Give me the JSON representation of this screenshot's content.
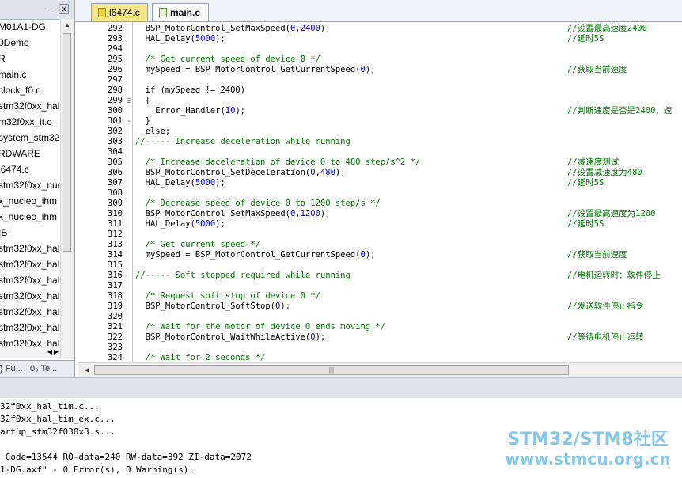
{
  "project_panel": {
    "pin_glyph": "―",
    "close_glyph": "×",
    "items": [
      "M01A1-DG",
      "0Demo",
      "R",
      "main.c",
      "clock_f0.c",
      "stm32f0xx_hal",
      "m32f0xx_it.c",
      "system_stm32",
      "RDWARE",
      "l6474.c",
      "stm32f0xx_nuc",
      "x_nucleo_ihm",
      "x_nucleo_ihm",
      "IB",
      "stm32f0xx_hal",
      "stm32f0xx_hal",
      "stm32f0xx_hal",
      "stm32f0xx_hal",
      "stm32f0xx_hal",
      "stm32f0xx_hal",
      "stm32f0xx_hal"
    ],
    "tabs": {
      "functions": "} Fu...",
      "templates": "0₀ Te..."
    }
  },
  "file_tabs": [
    {
      "label": "l6474.c",
      "active": false
    },
    {
      "label": "main.c",
      "active": true
    }
  ],
  "code_lines": [
    {
      "n": "292",
      "f": "",
      "c": "  BSP_MotorControl_SetMaxSpeed(0,2400);",
      "m": "//设置最高速度2400"
    },
    {
      "n": "293",
      "f": "",
      "c": "  HAL_Delay(5000);",
      "m": "//延时5S"
    },
    {
      "n": "294",
      "f": "",
      "c": "",
      "m": ""
    },
    {
      "n": "295",
      "f": "",
      "c": "  /* Get current speed of device 0 */",
      "m": ""
    },
    {
      "n": "296",
      "f": "",
      "c": "  mySpeed = BSP_MotorControl_GetCurrentSpeed(0);",
      "m": "//获取当前速度"
    },
    {
      "n": "297",
      "f": "",
      "c": "",
      "m": ""
    },
    {
      "n": "298",
      "f": "",
      "c": "  if (mySpeed != 2400)",
      "m": ""
    },
    {
      "n": "299",
      "f": "⊟",
      "c": "  {",
      "m": ""
    },
    {
      "n": "300",
      "f": "",
      "c": "    Error_Handler(10);",
      "m": "//判断速度是否是2400，速"
    },
    {
      "n": "301",
      "f": "-",
      "c": "  }",
      "m": ""
    },
    {
      "n": "302",
      "f": "",
      "c": "  else;",
      "m": ""
    },
    {
      "n": "303",
      "f": "",
      "c": "//----- Increase deceleration while running",
      "m": ""
    },
    {
      "n": "304",
      "f": "",
      "c": "",
      "m": ""
    },
    {
      "n": "305",
      "f": "",
      "c": "  /* Increase deceleration of device 0 to 480 step/s^2 */",
      "m": "//减速度测试"
    },
    {
      "n": "306",
      "f": "",
      "c": "  BSP_MotorControl_SetDeceleration(0,480);",
      "m": "//设置减速度为480"
    },
    {
      "n": "307",
      "f": "",
      "c": "  HAL_Delay(5000);",
      "m": "//延时5S"
    },
    {
      "n": "308",
      "f": "",
      "c": "",
      "m": ""
    },
    {
      "n": "309",
      "f": "",
      "c": "  /* Decrease speed of device 0 to 1200 step/s */",
      "m": ""
    },
    {
      "n": "310",
      "f": "",
      "c": "  BSP_MotorControl_SetMaxSpeed(0,1200);",
      "m": "//设置最高速度为1200"
    },
    {
      "n": "311",
      "f": "",
      "c": "  HAL_Delay(5000);",
      "m": "//延时5S"
    },
    {
      "n": "312",
      "f": "",
      "c": "",
      "m": ""
    },
    {
      "n": "313",
      "f": "",
      "c": "  /* Get current speed */",
      "m": ""
    },
    {
      "n": "314",
      "f": "",
      "c": "  mySpeed = BSP_MotorControl_GetCurrentSpeed(0);",
      "m": "//获取当前速度"
    },
    {
      "n": "315",
      "f": "",
      "c": "",
      "m": ""
    },
    {
      "n": "316",
      "f": "",
      "c": "//----- Soft stopped required while running",
      "m": "//电机运转时：软件停止"
    },
    {
      "n": "317",
      "f": "",
      "c": "",
      "m": ""
    },
    {
      "n": "318",
      "f": "",
      "c": "  /* Request soft stop of device 0 */",
      "m": ""
    },
    {
      "n": "319",
      "f": "",
      "c": "  BSP_MotorControl_SoftStop(0);",
      "m": "//发送软件停止指令"
    },
    {
      "n": "320",
      "f": "",
      "c": "",
      "m": ""
    },
    {
      "n": "321",
      "f": "",
      "c": "  /* Wait for the motor of device 0 ends moving */",
      "m": ""
    },
    {
      "n": "322",
      "f": "",
      "c": "  BSP_MotorControl_WaitWhileActive(0);",
      "m": "//等待电机停止运转"
    },
    {
      "n": "323",
      "f": "",
      "c": "",
      "m": ""
    },
    {
      "n": "324",
      "f": "",
      "c": "  /* Wait for 2 seconds */",
      "m": ""
    }
  ],
  "output_lines": [
    "32f0xx_hal_tim.c...",
    "32f0xx_hal_tim_ex.c...",
    "artup_stm32f030x8.s...",
    "",
    " Code=13544 RO-data=240 RW-data=392 ZI-data=2072",
    "1-DG.axf\" - 0 Error(s), 0 Warning(s)."
  ],
  "watermark": {
    "line1": "STM32/STM8社区",
    "line2": "www.stmcu.org.cn"
  },
  "colors": {
    "comment": "#007a00",
    "number": "#0000cc",
    "panel_header": "#dde4ee",
    "watermark": "#86c6e8"
  }
}
